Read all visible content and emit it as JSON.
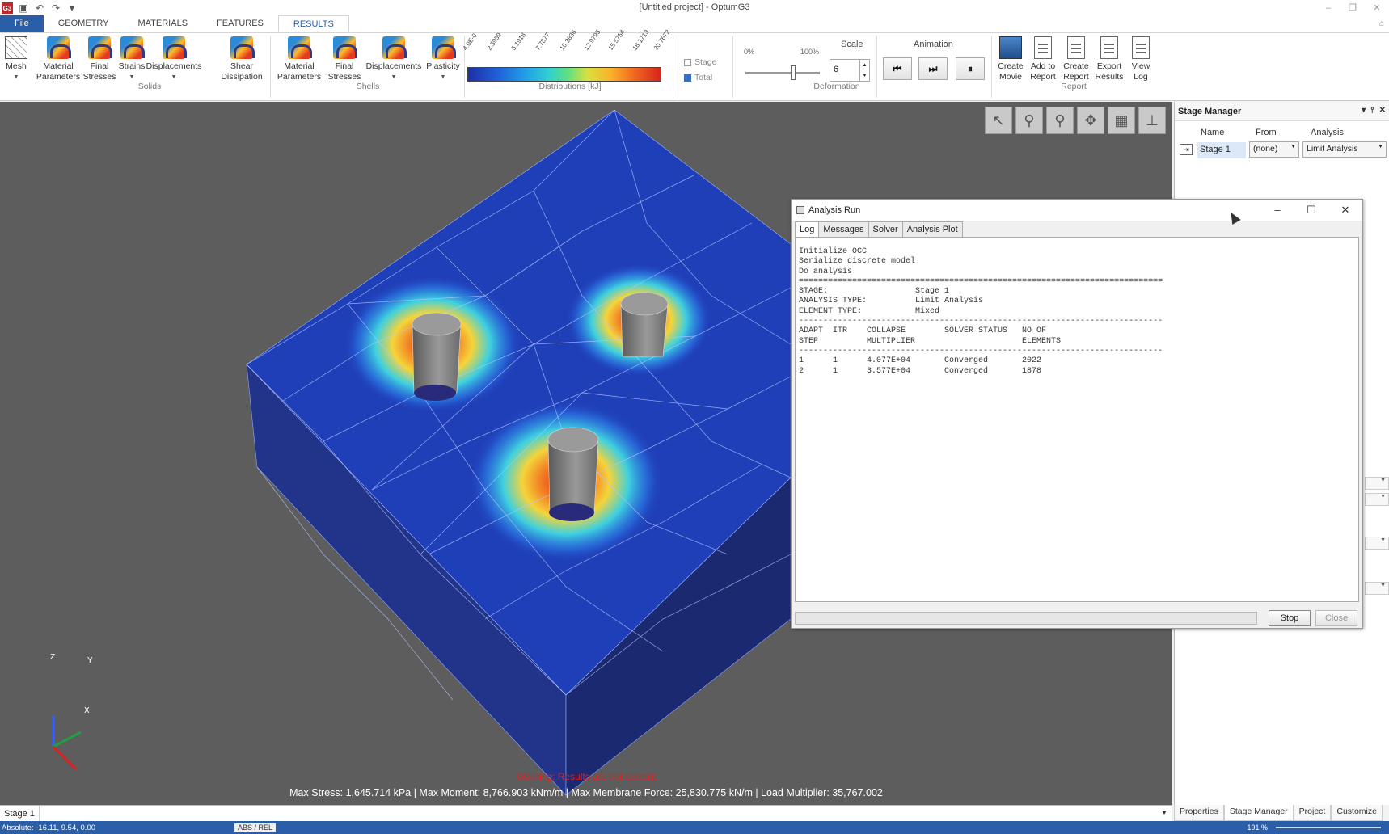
{
  "window": {
    "title": "[Untitled project] - OptumG3",
    "app_icon": "G3"
  },
  "menu": {
    "file": "File",
    "tabs": [
      "GEOMETRY",
      "MATERIALS",
      "FEATURES",
      "RESULTS"
    ],
    "active": "RESULTS"
  },
  "ribbon": {
    "mesh": "Mesh",
    "solids": {
      "group": "Solids",
      "items": [
        "Material Parameters",
        "Final Stresses",
        "Strains",
        "Displacements",
        "Shear Dissipation"
      ]
    },
    "shells": {
      "group": "Shells",
      "items": [
        "Material Parameters",
        "Final Stresses",
        "Displacements",
        "Plasticity"
      ]
    },
    "distributions": {
      "group": "Distributions [kJ]",
      "ticks": [
        "4.0E-0",
        "2.5959",
        "5.1918",
        "7.7877",
        "10.3836",
        "12.9795",
        "15.5754",
        "18.1713",
        "20.7672"
      ]
    },
    "view": {
      "stage": "Stage",
      "total": "Total",
      "stage_checked": false,
      "total_checked": true
    },
    "deformation": {
      "group": "Deformation",
      "min": "0%",
      "max": "100%",
      "scale_label": "Scale",
      "scale_value": "6",
      "slider_fraction": 0.62
    },
    "animation": {
      "label": "Animation"
    },
    "report": {
      "group": "Report",
      "items": [
        "Create Movie",
        "Add to Report",
        "Create Report",
        "Export Results",
        "View Log"
      ]
    }
  },
  "viewport": {
    "warning": "Warning: Results are not current",
    "stats": "Max Stress:  1,645.714 kPa | Max Moment:  8,766.903 kNm/m | Max Membrane Force:  25,830.775 kN/m | Load Multiplier:  35,767.002",
    "axes": {
      "z": "Z",
      "y": "Y",
      "x": "X"
    },
    "colors": {
      "background": "#5d5d5d",
      "mesh_low": "#1f3fb8",
      "mesh_high": "#d8251a"
    }
  },
  "stage_manager": {
    "title": "Stage Manager",
    "columns": [
      "Name",
      "From",
      "Analysis"
    ],
    "rows": [
      {
        "name": "Stage 1",
        "from": "(none)",
        "analysis": "Limit Analysis"
      }
    ]
  },
  "analysis_run": {
    "title": "Analysis Run",
    "tabs": [
      "Log",
      "Messages",
      "Solver",
      "Analysis Plot"
    ],
    "active_tab": "Log",
    "log": [
      "Initialize OCC",
      "Serialize discrete model",
      "Do analysis",
      "===========================================================================",
      "STAGE:                  Stage 1",
      "ANALYSIS TYPE:          Limit Analysis",
      "ELEMENT TYPE:           Mixed",
      "---------------------------------------------------------------------------",
      "ADAPT  ITR    COLLAPSE        SOLVER STATUS   NO OF",
      "STEP          MULTIPLIER                      ELEMENTS",
      "---------------------------------------------------------------------------",
      "1      1      4.077E+04       Converged       2022",
      "2      1      3.577E+04       Converged       1878"
    ],
    "stop": "Stop",
    "close": "Close"
  },
  "bottom": {
    "stage_tab": "Stage 1",
    "panel_tabs": [
      "Properties",
      "Stage Manager",
      "Project",
      "Customize"
    ],
    "active_panel_tab": "Stage Manager",
    "status": "Absolute: -16.11, 9.54, 0.00",
    "mode": "ABS / REL",
    "zoom": "191 %"
  }
}
